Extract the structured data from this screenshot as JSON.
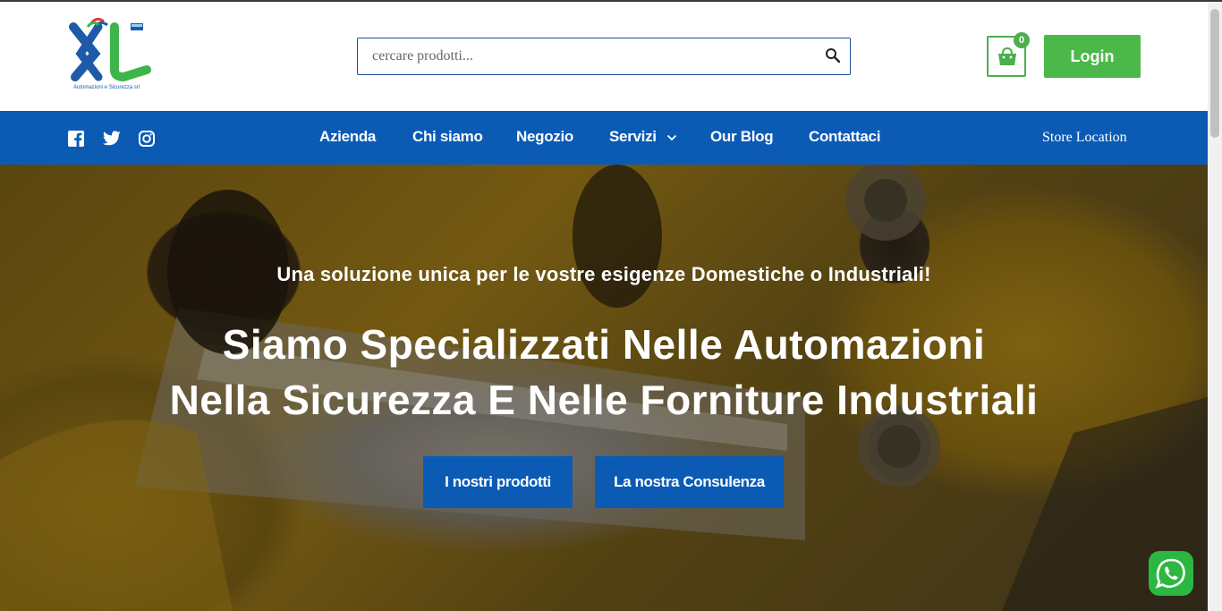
{
  "header": {
    "logo_tagline": "Automazioni e Sicurezza srl",
    "search": {
      "placeholder": "cercare prodotti..."
    },
    "cart": {
      "count": "0"
    },
    "login_label": "Login"
  },
  "nav": {
    "social": [
      "facebook-icon",
      "twitter-icon",
      "instagram-icon"
    ],
    "links": [
      "Azienda",
      "Chi siamo",
      "Negozio",
      "Servizi",
      "Our Blog",
      "Contattaci"
    ],
    "store_location": "Store Location"
  },
  "hero": {
    "subtitle": "Una soluzione unica per le vostre esigenze Domestiche o Industriali!",
    "title_line1": "Siamo Specializzati Nelle Automazioni",
    "title_line2": "Nella Sicurezza E Nelle Forniture Industriali",
    "btn_products": "I nostri prodotti",
    "btn_consulting": "La nostra Consulenza"
  },
  "colors": {
    "primary_blue": "#0b5bb5",
    "green": "#4db84a",
    "whatsapp_green": "#2bb741"
  }
}
